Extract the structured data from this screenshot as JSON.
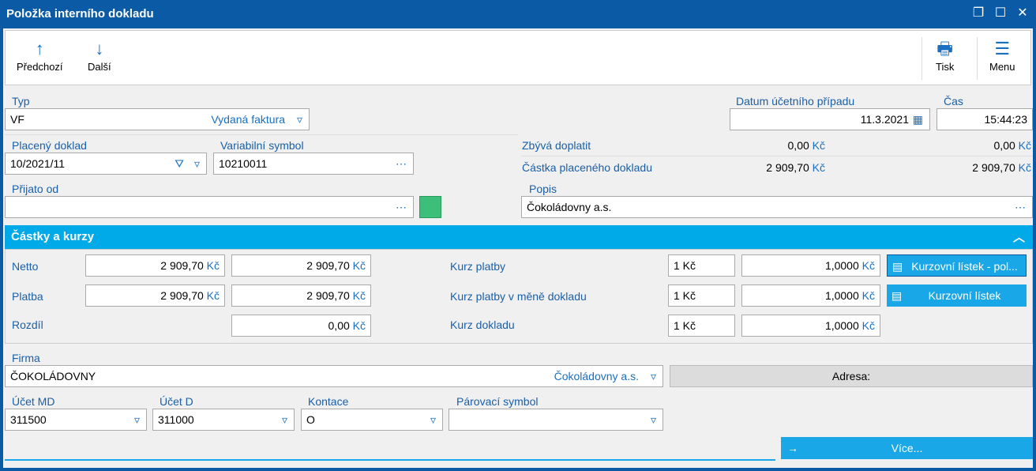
{
  "window": {
    "title": "Položka interního dokladu"
  },
  "toolbar": {
    "prev": "Předchozí",
    "next": "Další",
    "print": "Tisk",
    "menu": "Menu"
  },
  "typ": {
    "label": "Typ",
    "code": "VF",
    "name": "Vydaná faktura"
  },
  "datum": {
    "label": "Datum účetního případu",
    "value": "11.3.2021"
  },
  "cas": {
    "label": "Čas",
    "value": "15:44:23"
  },
  "placeny": {
    "label": "Placený doklad",
    "value": "10/2021/11"
  },
  "vs": {
    "label": "Variabilní symbol",
    "value": "10210011"
  },
  "zbyva": {
    "label": "Zbývá doplatit",
    "v1": "0,00",
    "v2": "0,00"
  },
  "castka": {
    "label": "Částka placeného dokladu",
    "v1": "2 909,70",
    "v2": "2 909,70"
  },
  "currency": "Kč",
  "prijato": {
    "label": "Přijato od",
    "value": ""
  },
  "popis": {
    "label": "Popis",
    "value": "Čokoládovny a.s."
  },
  "section": {
    "title": "Částky a kurzy"
  },
  "netto": {
    "label": "Netto",
    "v1": "2 909,70",
    "v2": "2 909,70"
  },
  "platba": {
    "label": "Platba",
    "v1": "2 909,70",
    "v2": "2 909,70"
  },
  "rozdil": {
    "label": "Rozdíl",
    "v2": "0,00"
  },
  "kurzPlatby": {
    "label": "Kurz platby",
    "unit": "1 Kč",
    "rate": "1,0000"
  },
  "kurzPlatbyMena": {
    "label": "Kurz platby v měně dokladu",
    "unit": "1 Kč",
    "rate": "1,0000"
  },
  "kurzDokladu": {
    "label": "Kurz dokladu",
    "unit": "1 Kč",
    "rate": "1,0000"
  },
  "buttons": {
    "kurz1": "Kurzovní lístek - pol...",
    "kurz2": "Kurzovní lístek",
    "adresa": "Adresa:",
    "vice": "Více..."
  },
  "firma": {
    "label": "Firma",
    "code": "ČOKOLÁDOVNY",
    "name": "Čokoládovny a.s."
  },
  "ucetMD": {
    "label": "Účet MD",
    "value": "311500"
  },
  "ucetD": {
    "label": "Účet D",
    "value": "311000"
  },
  "kontace": {
    "label": "Kontace",
    "value": "O"
  },
  "parovaci": {
    "label": "Párovací symbol",
    "value": ""
  }
}
